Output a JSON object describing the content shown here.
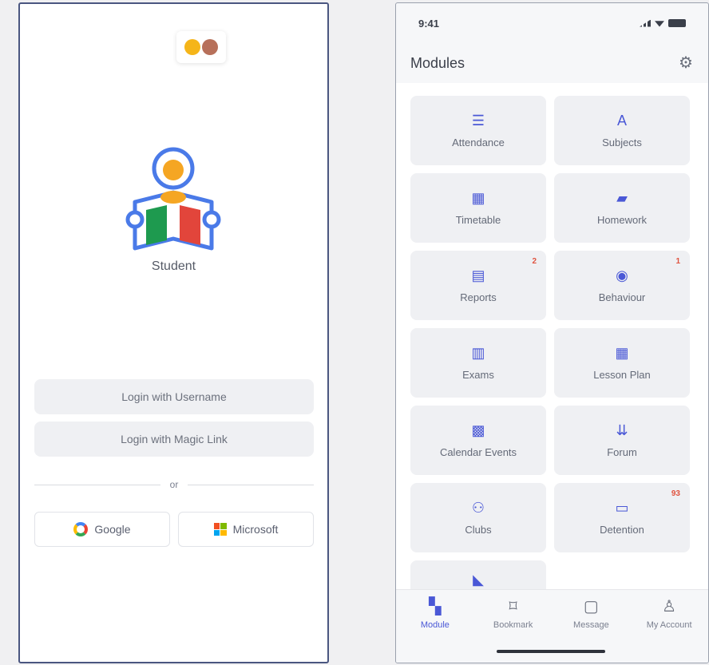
{
  "login": {
    "role_label": "Student",
    "login_username": "Login with Username",
    "login_magic": "Login with Magic Link",
    "divider_text": "or",
    "google_label": "Google",
    "microsoft_label": "Microsoft"
  },
  "colors": {
    "accent": "#4a58d6",
    "badge": "#e0533f",
    "tile_bg": "#eff0f3"
  },
  "modules_screen": {
    "status_time": "9:41",
    "title": "Modules",
    "settings_icon": "gear-icon",
    "items": [
      {
        "label": "Attendance",
        "icon": "attendance-icon",
        "badge": ""
      },
      {
        "label": "Subjects",
        "icon": "subjects-icon",
        "badge": ""
      },
      {
        "label": "Timetable",
        "icon": "calendar-icon",
        "badge": ""
      },
      {
        "label": "Homework",
        "icon": "homework-icon",
        "badge": ""
      },
      {
        "label": "Reports",
        "icon": "document-icon",
        "badge": "2"
      },
      {
        "label": "Behaviour",
        "icon": "eye-icon",
        "badge": "1"
      },
      {
        "label": "Exams",
        "icon": "exam-icon",
        "badge": ""
      },
      {
        "label": "Lesson Plan",
        "icon": "calendar-icon",
        "badge": ""
      },
      {
        "label": "Calendar Events",
        "icon": "calendar-event-icon",
        "badge": ""
      },
      {
        "label": "Forum",
        "icon": "forum-icon",
        "badge": ""
      },
      {
        "label": "Clubs",
        "icon": "clubs-icon",
        "badge": ""
      },
      {
        "label": "Detention",
        "icon": "detention-icon",
        "badge": "93"
      }
    ],
    "nav": [
      {
        "label": "Module",
        "icon": "grid-icon",
        "active": true
      },
      {
        "label": "Bookmark",
        "icon": "bookmark-icon",
        "active": false
      },
      {
        "label": "Message",
        "icon": "message-icon",
        "active": false
      },
      {
        "label": "My Account",
        "icon": "user-icon",
        "active": false
      }
    ]
  }
}
